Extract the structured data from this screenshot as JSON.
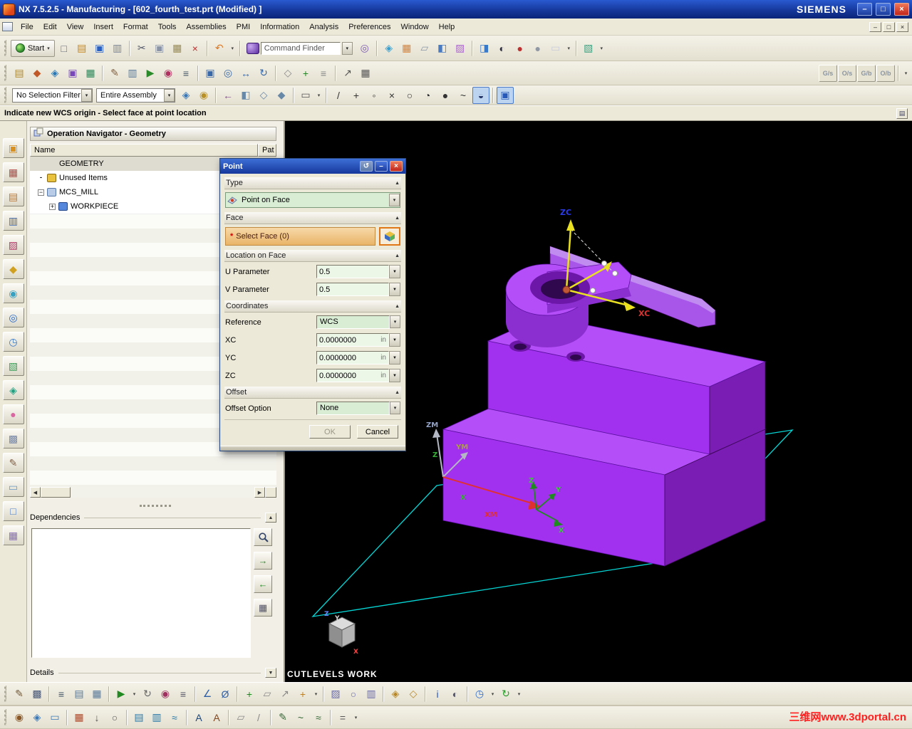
{
  "window": {
    "title": "NX 7.5.2.5 - Manufacturing - [602_fourth_test.prt (Modified) ]",
    "brand": "SIEMENS",
    "controls": {
      "minimize": "–",
      "restore": "□",
      "close": "×"
    }
  },
  "ui": {
    "dd": "▾",
    "up": "▲",
    "down": "▼",
    "left": "◀",
    "right": "▶",
    "next": "→",
    "prev": "←",
    "grid": "▦",
    "panel": "▤",
    "reset": "↺"
  },
  "menu": {
    "items": [
      "File",
      "Edit",
      "View",
      "Insert",
      "Format",
      "Tools",
      "Assemblies",
      "PMI",
      "Information",
      "Analysis",
      "Preferences",
      "Window",
      "Help"
    ],
    "mdi_controls": [
      "–",
      "□",
      "×"
    ]
  },
  "toolbar1": {
    "start_label": "Start",
    "finder_label": "Command Finder",
    "icons_a": [
      {
        "n": "new-icon",
        "g": "□",
        "c": "#606878"
      },
      {
        "n": "open-icon",
        "g": "▤",
        "c": "#c8861a"
      },
      {
        "n": "save-icon",
        "g": "▣",
        "c": "#2b5fc0"
      },
      {
        "n": "plot-icon",
        "g": "▥",
        "c": "#7a8699"
      },
      {
        "cls": "sep",
        "ia": "false"
      },
      {
        "n": "cut-icon",
        "g": "✂",
        "c": "#50586a"
      },
      {
        "n": "copy-icon",
        "g": "▣",
        "c": "#8a94a6"
      },
      {
        "n": "paste-icon",
        "g": "▦",
        "c": "#9a8a4a"
      },
      {
        "n": "delete-icon",
        "g": "×",
        "c": "#c03030"
      },
      {
        "cls": "sep",
        "ia": "false"
      },
      {
        "n": "undo-icon",
        "g": "↶",
        "c": "#e07820"
      },
      {
        "n": "undo-dropdown-icon",
        "g": "▾",
        "c": "#444",
        "cls": "dd"
      },
      {
        "cls": "sep",
        "ia": "false"
      }
    ],
    "icons_b": [
      {
        "n": "repeat-command-icon",
        "g": "◎",
        "c": "#7a5ab0"
      },
      {
        "cls": "sep",
        "ia": "false"
      },
      {
        "n": "touch-mode-icon",
        "g": "◈",
        "c": "#38a0d0"
      },
      {
        "n": "screenshot-icon",
        "g": "▦",
        "c": "#e08030"
      },
      {
        "n": "work-plane-icon",
        "g": "▱",
        "c": "#8a98a8"
      },
      {
        "n": "true-shading-icon",
        "g": "◧",
        "c": "#4a7ac0"
      },
      {
        "n": "orient-view-icon",
        "g": "▨",
        "c": "#aa66cc"
      },
      {
        "cls": "sep",
        "ia": "false"
      },
      {
        "n": "shaded-view-icon",
        "g": "◨",
        "c": "#3a78c8"
      },
      {
        "n": "render-style-icon",
        "g": "◐",
        "c": "#303040"
      },
      {
        "n": "material-red-icon",
        "g": "●",
        "c": "#c03030"
      },
      {
        "n": "material-gray-icon",
        "g": "●",
        "c": "#9098a4"
      },
      {
        "n": "background-swatch",
        "g": "▭",
        "c": "#c8ccd8"
      },
      {
        "n": "swatch-dropdown-icon",
        "g": "▾",
        "c": "#444",
        "cls": "dd"
      },
      {
        "cls": "sep",
        "ia": "false"
      },
      {
        "n": "new-window-icon",
        "g": "▧",
        "c": "#40a080"
      },
      {
        "n": "window-dropdown-icon",
        "g": "▾",
        "c": "#444",
        "cls": "dd"
      }
    ]
  },
  "toolbar2": {
    "icons": [
      {
        "cls": "grip",
        "ia": "false"
      },
      {
        "n": "create-program-icon",
        "g": "▤",
        "c": "#b08828"
      },
      {
        "n": "create-tool-icon",
        "g": "◆",
        "c": "#c05828"
      },
      {
        "n": "create-geometry-icon",
        "g": "◈",
        "c": "#2878b8"
      },
      {
        "n": "create-method-icon",
        "g": "▣",
        "c": "#7848b8"
      },
      {
        "n": "create-operation-icon",
        "g": "▦",
        "c": "#288858"
      },
      {
        "cls": "sep",
        "ia": "false"
      },
      {
        "n": "edit-object-icon",
        "g": "✎",
        "c": "#806040"
      },
      {
        "n": "cut-level-icon",
        "g": "▥",
        "c": "#587898"
      },
      {
        "n": "generate-toolpath-icon",
        "g": "▶",
        "c": "#2a8a2a"
      },
      {
        "n": "verify-toolpath-icon",
        "g": "◉",
        "c": "#b03060"
      },
      {
        "n": "post-process-icon",
        "g": "≡",
        "c": "#485868"
      },
      {
        "cls": "sep",
        "ia": "false"
      },
      {
        "n": "fit-view-icon",
        "g": "▣",
        "c": "#3868a8"
      },
      {
        "n": "zoom-icon",
        "g": "◎",
        "c": "#3868a8"
      },
      {
        "n": "pan-icon",
        "g": "↔",
        "c": "#3868a8"
      },
      {
        "n": "rotate-view-icon",
        "g": "↻",
        "c": "#3868a8"
      },
      {
        "cls": "sep",
        "ia": "false"
      },
      {
        "n": "snap-view-icon",
        "g": "◇",
        "c": "#888888"
      },
      {
        "n": "wcs-display-icon",
        "g": "+",
        "c": "#208820"
      },
      {
        "n": "layer-settings-icon",
        "g": "≡",
        "c": "#888888"
      },
      {
        "cls": "sep",
        "ia": "false"
      },
      {
        "n": "move-object-icon",
        "g": "↗",
        "c": "#555555"
      },
      {
        "n": "pattern-icon",
        "g": "▦",
        "c": "#555555"
      },
      {
        "cls": "gap",
        "ia": "false"
      },
      {
        "n": "gcode-simulate-button",
        "g": "G/s",
        "cls": "txt"
      },
      {
        "n": "ocode-simulate-button",
        "g": "O/s",
        "cls": "txt"
      },
      {
        "n": "gcode-build-button",
        "g": "G/b",
        "cls": "txt"
      },
      {
        "n": "ocode-build-button",
        "g": "O/b",
        "cls": "txt"
      },
      {
        "cls": "sep",
        "ia": "false"
      },
      {
        "n": "toolbar-options-icon",
        "g": "▾",
        "c": "#444",
        "cls": "dd"
      }
    ]
  },
  "selection_bar": {
    "filter_value": "No Selection Filter",
    "scope_value": "Entire Assembly",
    "icons": [
      {
        "n": "selection-scope-icon",
        "g": "◈",
        "c": "#3878b8"
      },
      {
        "n": "highlight-icon",
        "g": "◉",
        "c": "#b89028"
      },
      {
        "cls": "sep",
        "ia": "false"
      },
      {
        "n": "previous-selection-icon",
        "g": "←",
        "c": "#884898"
      },
      {
        "n": "select-face-mode-icon",
        "g": "◧",
        "c": "#6888a8"
      },
      {
        "n": "select-edge-mode-icon",
        "g": "◇",
        "c": "#6888a8"
      },
      {
        "n": "select-body-mode-icon",
        "g": "◆",
        "c": "#6888a8"
      },
      {
        "cls": "sep",
        "ia": "false"
      },
      {
        "n": "rectangle-select-icon",
        "g": "▭",
        "c": "#555555"
      },
      {
        "n": "select-dropdown-icon",
        "g": "▾",
        "c": "#444",
        "cls": "dd"
      },
      {
        "cls": "sep",
        "ia": "false"
      },
      {
        "n": "snap-endpoint-icon",
        "g": "/",
        "c": "#333333"
      },
      {
        "n": "snap-midpoint-icon",
        "g": "+",
        "c": "#333333"
      },
      {
        "n": "snap-control-point-icon",
        "g": "◦",
        "c": "#333333"
      },
      {
        "n": "snap-intersection-icon",
        "g": "×",
        "c": "#333333"
      },
      {
        "n": "snap-arc-center-icon",
        "g": "○",
        "c": "#333333"
      },
      {
        "n": "snap-quadrant-icon",
        "g": "◔",
        "c": "#333333"
      },
      {
        "n": "snap-existing-point-icon",
        "g": "●",
        "c": "#333333"
      },
      {
        "n": "snap-point-on-curve-icon",
        "g": "~",
        "c": "#333333"
      },
      {
        "n": "snap-point-on-face-icon",
        "g": "◒",
        "c": "#223366",
        "cls": "active"
      },
      {
        "cls": "sep",
        "ia": "false"
      },
      {
        "n": "snap-point-toggle-icon",
        "g": "▣",
        "c": "#2858b8",
        "cls": "active"
      }
    ]
  },
  "prompt": {
    "text": "Indicate new WCS origin - Select face at point location"
  },
  "left_strip": {
    "icons": [
      {
        "n": "assembly-navigator-icon",
        "g": "▣",
        "c": "#d89020"
      },
      {
        "n": "constraint-navigator-icon",
        "g": "▦",
        "c": "#c04040"
      },
      {
        "n": "part-navigator-icon",
        "g": "▤",
        "c": "#c07830"
      },
      {
        "n": "operation-navigator-icon",
        "g": "▥",
        "c": "#3868b8"
      },
      {
        "n": "machine-tool-navigator-icon",
        "g": "▨",
        "c": "#b83868"
      },
      {
        "n": "reuse-library-icon",
        "g": "◆",
        "c": "#d0a020"
      },
      {
        "n": "hd3d-tools-icon",
        "g": "◉",
        "c": "#38a0c0"
      },
      {
        "n": "web-browser-icon",
        "g": "◎",
        "c": "#2868c8"
      },
      {
        "n": "history-icon",
        "g": "◷",
        "c": "#3878c8"
      },
      {
        "n": "process-studio-icon",
        "g": "▧",
        "c": "#38a058"
      },
      {
        "n": "manufacturing-wizards-icon",
        "g": "◈",
        "c": "#20a080"
      },
      {
        "n": "roles-icon",
        "g": "●",
        "c": "#d868a0"
      },
      {
        "n": "system-scenes-icon",
        "g": "▩",
        "c": "#7888a8"
      },
      {
        "n": "user-tools-icon",
        "g": "✎",
        "c": "#806048"
      },
      {
        "n": "touch-panel-icon",
        "g": "▭",
        "c": "#6898c8"
      },
      {
        "n": "window-shade-icon",
        "g": "□",
        "c": "#4878c0"
      },
      {
        "n": "palettes-icon",
        "g": "▦",
        "c": "#8868c8"
      }
    ]
  },
  "navigator": {
    "title": "Operation Navigator - Geometry",
    "columns": {
      "name": "Name",
      "path": "Pat"
    },
    "tree": [
      {
        "n": "tree-row-geometry",
        "label": "GEOMETRY",
        "ind": "4px",
        "exp": "",
        "expcls": "noexp",
        "iconcls": "noicon",
        "rowcls": "hdr"
      },
      {
        "n": "tree-row-unused-items",
        "label": "Unused Items",
        "ind": "4px",
        "exp": "-",
        "expcls": "bare",
        "icon": "#e8c23c",
        "iconborder": "#8a6a10"
      },
      {
        "n": "tree-row-mcs-mill",
        "label": "MCS_MILL",
        "ind": "4px",
        "exp": "−",
        "expcls": "box",
        "icon": "#b8cce8",
        "iconborder": "#5878a8"
      },
      {
        "n": "tree-row-workpiece",
        "label": "WORKPIECE",
        "ind": "20px",
        "exp": "+",
        "expcls": "box",
        "icon": "#5588dd",
        "iconborder": "#224488"
      }
    ],
    "dependencies_label": "Dependencies",
    "details_label": "Details"
  },
  "dialog": {
    "title": "Point",
    "controls": {
      "reset": "↺",
      "minimize": "–",
      "close": "×"
    },
    "sections": {
      "type": "Type",
      "face": "Face",
      "location": "Location on Face",
      "coordinates": "Coordinates",
      "offset": "Offset"
    },
    "type_value": "Point on Face",
    "select_face": {
      "star": "*",
      "label": "Select Face (0)"
    },
    "u_param": {
      "label": "U Parameter",
      "value": "0.5"
    },
    "v_param": {
      "label": "V Parameter",
      "value": "0.5"
    },
    "reference": {
      "label": "Reference",
      "value": "WCS"
    },
    "xc": {
      "label": "XC",
      "value": "0.0000000",
      "unit": "in"
    },
    "yc": {
      "label": "YC",
      "value": "0.0000000",
      "unit": "in"
    },
    "zc": {
      "label": "ZC",
      "value": "0.0000000",
      "unit": "in"
    },
    "offset_option": {
      "label": "Offset Option",
      "value": "None"
    },
    "ok": "OK",
    "cancel": "Cancel"
  },
  "viewport": {
    "status_text": "CUTLEVELS WORK",
    "labels": {
      "zc": "ZC",
      "xc": "XC",
      "zm": "ZM",
      "ym": "YM",
      "xm": "XM",
      "mz": "Z",
      "mx": "X",
      "wz": "Z",
      "wy": "Y",
      "wx": "X",
      "cz": "Z",
      "cy": "Y",
      "cx": "X"
    },
    "colors": {
      "face_top": "#b44ef8",
      "face_front": "#a231ef",
      "face_side": "#7a1db5",
      "boss_side": "#8b2fd0",
      "arm": "#a855ea",
      "arm_highlight": "#c08cf0",
      "hole_mid": "#6d17a8",
      "hole_dark": "#30084e",
      "boundary": "#00d8d8",
      "axis_yellow": "#e8e020"
    }
  },
  "bottom1": {
    "icons": [
      {
        "cls": "grip",
        "ia": "false"
      },
      {
        "n": "edit-tool-icon",
        "g": "✎",
        "c": "#705838"
      },
      {
        "n": "edit-display-icon",
        "g": "▩",
        "c": "#485878"
      },
      {
        "cls": "sep",
        "ia": "false"
      },
      {
        "n": "toolpath-list-icon",
        "g": "≡",
        "c": "#445566"
      },
      {
        "n": "show-2d-path-icon",
        "g": "▤",
        "c": "#587898"
      },
      {
        "n": "machine-simulation-icon",
        "g": "▦",
        "c": "#587898"
      },
      {
        "cls": "sep",
        "ia": "false"
      },
      {
        "n": "generate-icon",
        "g": "▶",
        "c": "#228822"
      },
      {
        "n": "generate-dropdown-icon",
        "g": "▾",
        "c": "#444",
        "cls": "dd"
      },
      {
        "n": "replay-icon",
        "g": "↻",
        "c": "#666666"
      },
      {
        "n": "verify-icon",
        "g": "◉",
        "c": "#a03060"
      },
      {
        "n": "post-icon",
        "g": "≡",
        "c": "#555566"
      },
      {
        "cls": "sep",
        "ia": "false"
      },
      {
        "n": "measure-angle-icon",
        "g": "∠",
        "c": "#3060a8"
      },
      {
        "n": "measure-diameter-icon",
        "g": "Ø",
        "c": "#3060a8"
      },
      {
        "cls": "sep",
        "ia": "false"
      },
      {
        "n": "point-constructor-icon",
        "g": "+",
        "c": "#208820"
      },
      {
        "n": "plane-constructor-icon",
        "g": "▱",
        "c": "#888888"
      },
      {
        "n": "vector-constructor-icon",
        "g": "↗",
        "c": "#888888"
      },
      {
        "n": "csys-constructor-icon",
        "g": "+",
        "c": "#c08020"
      },
      {
        "n": "csys-dropdown-icon",
        "g": "▾",
        "c": "#444",
        "cls": "dd"
      },
      {
        "cls": "sep",
        "ia": "false"
      },
      {
        "n": "object-display-icon",
        "g": "▨",
        "c": "#6868a8"
      },
      {
        "n": "hide-object-icon",
        "g": "○",
        "c": "#6868a8"
      },
      {
        "n": "layer-icon",
        "g": "▥",
        "c": "#6868a8"
      },
      {
        "cls": "sep",
        "ia": "false"
      },
      {
        "n": "wcs-dynamics-icon",
        "g": "◈",
        "c": "#b88828"
      },
      {
        "n": "wcs-orient-icon",
        "g": "◇",
        "c": "#b88828"
      },
      {
        "cls": "sep",
        "ia": "false"
      },
      {
        "n": "information-icon",
        "g": "i",
        "c": "#2858c8"
      },
      {
        "n": "analysis-icon",
        "g": "◐",
        "c": "#555566"
      },
      {
        "cls": "sep",
        "ia": "false"
      },
      {
        "n": "clock-icon",
        "g": "◷",
        "c": "#2a6ad0"
      },
      {
        "n": "clock-dropdown-icon",
        "g": "▾",
        "c": "#444",
        "cls": "dd"
      },
      {
        "n": "refresh-icon",
        "g": "↻",
        "c": "#2a9a2a"
      },
      {
        "n": "refresh-dropdown-icon",
        "g": "▾",
        "c": "#444",
        "cls": "dd"
      }
    ]
  },
  "bottom2": {
    "icons": [
      {
        "cls": "grip",
        "ia": "false"
      },
      {
        "n": "snapshot-icon",
        "g": "◉",
        "c": "#885828"
      },
      {
        "n": "bounding-cube-icon",
        "g": "◈",
        "c": "#3a78b8"
      },
      {
        "n": "boundary-icon",
        "g": "▭",
        "c": "#3a78b8"
      },
      {
        "cls": "sep",
        "ia": "false"
      },
      {
        "n": "mill-area-icon",
        "g": "▦",
        "c": "#b04828"
      },
      {
        "n": "drill-icon",
        "g": "↓",
        "c": "#555555"
      },
      {
        "n": "hole-icon",
        "g": "○",
        "c": "#555555"
      },
      {
        "cls": "sep",
        "ia": "false"
      },
      {
        "n": "face-milling-icon",
        "g": "▤",
        "c": "#2878a8"
      },
      {
        "n": "cavity-mill-icon",
        "g": "▥",
        "c": "#2878a8"
      },
      {
        "n": "zlevel-icon",
        "g": "≈",
        "c": "#2878a8"
      },
      {
        "cls": "sep",
        "ia": "false"
      },
      {
        "n": "text-icon",
        "g": "A",
        "c": "#204878"
      },
      {
        "n": "annotation-icon",
        "g": "A",
        "c": "#804820"
      },
      {
        "cls": "sep",
        "ia": "false"
      },
      {
        "n": "datum-plane-icon",
        "g": "▱",
        "c": "#888888"
      },
      {
        "n": "datum-axis-icon",
        "g": "/",
        "c": "#888888"
      },
      {
        "cls": "sep",
        "ia": "false"
      },
      {
        "n": "sketch-icon",
        "g": "✎",
        "c": "#386838"
      },
      {
        "n": "curve-icon",
        "g": "~",
        "c": "#386838"
      },
      {
        "n": "spline-icon",
        "g": "≈",
        "c": "#386838"
      },
      {
        "cls": "sep",
        "ia": "false"
      },
      {
        "n": "expressions-icon",
        "g": "=",
        "c": "#555555"
      },
      {
        "n": "more-dropdown-icon",
        "g": "▾",
        "c": "#444",
        "cls": "dd"
      }
    ]
  },
  "watermark": {
    "text": "三维网www.3dportal.cn",
    "color": "#ff2020"
  }
}
